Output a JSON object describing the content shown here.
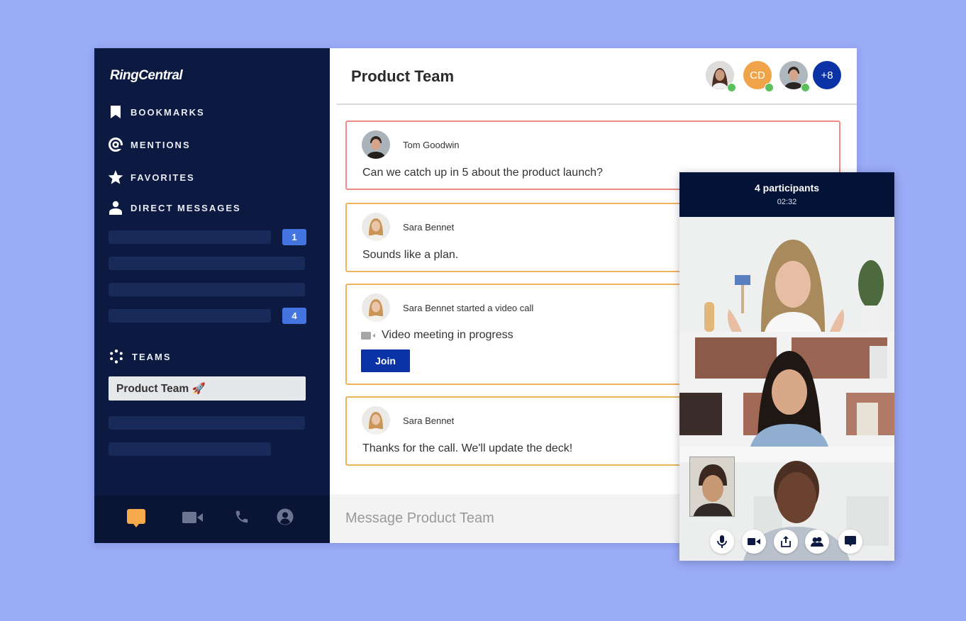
{
  "brand": {
    "logo_text": "RingCentral"
  },
  "sidebar": {
    "nav": [
      {
        "label": "BOOKMARKS",
        "icon": "bookmark-icon"
      },
      {
        "label": "MENTIONS",
        "icon": "at-sign-icon"
      },
      {
        "label": "FAVORITES",
        "icon": "star-icon"
      },
      {
        "label": "DIRECT MESSAGES",
        "icon": "person-icon"
      }
    ],
    "direct_message_badges": [
      "1",
      "4"
    ],
    "teams_label": "TEAMS",
    "teams_icon": "teams-dots-icon",
    "selected_team": "Product Team 🚀",
    "footer_icons": [
      "message-icon",
      "video-icon",
      "phone-icon",
      "contacts-icon"
    ]
  },
  "colors": {
    "sidebar_bg": "#0c1940",
    "badge": "#4374e0",
    "urgent_border": "#ef8a84",
    "card_border": "#f0b25a",
    "join_button": "#0c33a6",
    "online": "#5cc15c",
    "active_footer_icon": "#f5a94a"
  },
  "main": {
    "title": "Product Team",
    "members": [
      {
        "type": "photo",
        "name": "member-woman"
      },
      {
        "type": "initials",
        "initials": "CD",
        "color": "#f0a44a"
      },
      {
        "type": "photo",
        "name": "member-man"
      },
      {
        "type": "more",
        "label": "+8",
        "color": "#0c33a6"
      }
    ],
    "messages": [
      {
        "author": "Tom Goodwin",
        "text": "Can we catch up in 5 about the product launch?",
        "style": "urgent"
      },
      {
        "author": "Sara Bennet",
        "text": "Sounds like a plan.",
        "style": "normal"
      },
      {
        "author": "Sara Bennet started a video call",
        "text": "Video meeting in progress",
        "button": "Join",
        "style": "normal"
      },
      {
        "author": "Sara Bennet",
        "text": "Thanks for the call. We'll update the deck!",
        "style": "normal"
      }
    ],
    "composer_placeholder": "Message Product Team"
  },
  "video_call": {
    "participants_label": "4 participants",
    "duration": "02:32",
    "controls": [
      "microphone-icon",
      "camera-icon",
      "share-screen-icon",
      "participants-icon",
      "chat-icon"
    ]
  }
}
